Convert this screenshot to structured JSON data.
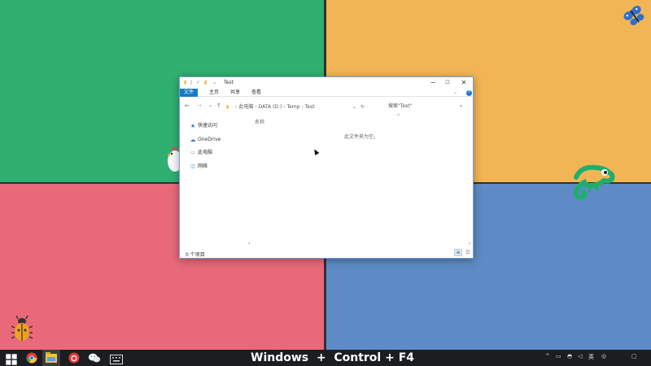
{
  "explorer": {
    "title": "Test",
    "ribbon_tabs": [
      "文件",
      "主页",
      "共享",
      "查看"
    ],
    "address_path": [
      "此电脑",
      "DATA (D:)",
      "Temp",
      "Test"
    ],
    "search_placeholder": "搜索\"Test\"",
    "nav_items": [
      {
        "label": "快速访问",
        "icon": "star-icon"
      },
      {
        "label": "OneDrive",
        "icon": "cloud-icon"
      },
      {
        "label": "此电脑",
        "icon": "computer-icon"
      },
      {
        "label": "网络",
        "icon": "network-icon"
      }
    ],
    "column_header": "名称",
    "empty_message": "此文件夹为空。",
    "status_text": "0 个项目"
  },
  "taskbar": {
    "shortcut_text": "Windows  +  Control + F4",
    "icons": [
      "windows-start-icon",
      "chrome-icon",
      "file-explorer-icon",
      "netease-music-icon",
      "wechat-icon",
      "keyboard-icon"
    ]
  },
  "colors": {
    "green": "#2fb070",
    "orange": "#f2b555",
    "red": "#e9697a",
    "blue": "#5e8bc5",
    "accent": "#1979ca"
  }
}
